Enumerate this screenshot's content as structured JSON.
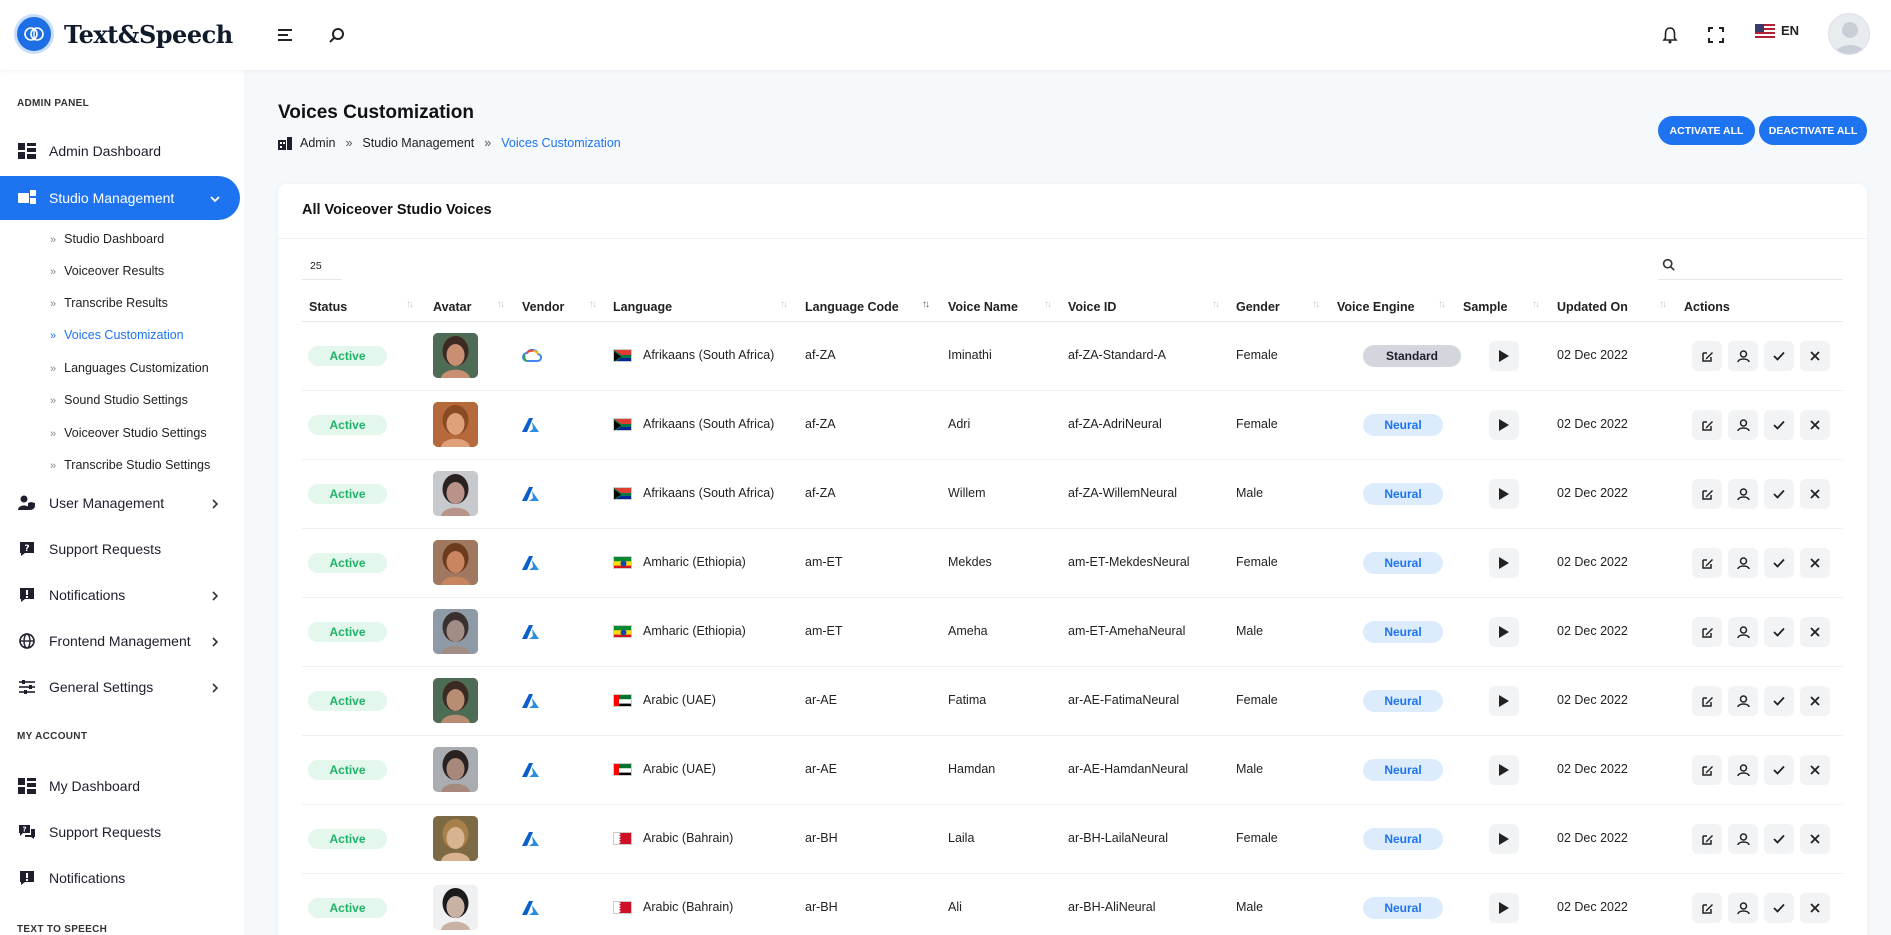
{
  "app": {
    "logo_text": "Text&Speech",
    "language": "EN"
  },
  "sidebar": {
    "section_admin": "ADMIN PANEL",
    "admin_dashboard": "Admin Dashboard",
    "studio_management": "Studio Management",
    "sub_items": [
      "Studio Dashboard",
      "Voiceover Results",
      "Transcribe Results",
      "Voices Customization",
      "Languages Customization",
      "Sound Studio Settings",
      "Voiceover Studio Settings",
      "Transcribe Studio Settings"
    ],
    "user_management": "User Management",
    "support_requests": "Support Requests",
    "notifications": "Notifications",
    "frontend_management": "Frontend Management",
    "general_settings": "General Settings",
    "section_account": "MY ACCOUNT",
    "my_dashboard": "My Dashboard",
    "my_support_requests": "Support Requests",
    "my_notifications": "Notifications",
    "section_tts": "TEXT TO SPEECH"
  },
  "header": {
    "title": "Voices Customization",
    "breadcrumb": [
      "Admin",
      "Studio Management",
      "Voices Customization"
    ],
    "breadcrumb_sep": "»",
    "activate_all": "ACTIVATE ALL",
    "deactivate_all": "DEACTIVATE ALL"
  },
  "card": {
    "title": "All Voiceover Studio Voices",
    "page_size": "25"
  },
  "table": {
    "columns": [
      "Status",
      "Avatar",
      "Vendor",
      "Language",
      "Language Code",
      "Voice Name",
      "Voice ID",
      "Gender",
      "Voice Engine",
      "Sample",
      "Updated On",
      "Actions"
    ],
    "rows": [
      {
        "status": "Active",
        "vendor": "gcp",
        "language": "Afrikaans (South Africa)",
        "flag": "za",
        "code": "af-ZA",
        "name": "Iminathi",
        "id": "af-ZA-Standard-A",
        "gender": "Female",
        "engine": "Standard",
        "updated": "02 Dec 2022"
      },
      {
        "status": "Active",
        "vendor": "azure",
        "language": "Afrikaans (South Africa)",
        "flag": "za",
        "code": "af-ZA",
        "name": "Adri",
        "id": "af-ZA-AdriNeural",
        "gender": "Female",
        "engine": "Neural",
        "updated": "02 Dec 2022"
      },
      {
        "status": "Active",
        "vendor": "azure",
        "language": "Afrikaans (South Africa)",
        "flag": "za",
        "code": "af-ZA",
        "name": "Willem",
        "id": "af-ZA-WillemNeural",
        "gender": "Male",
        "engine": "Neural",
        "updated": "02 Dec 2022"
      },
      {
        "status": "Active",
        "vendor": "azure",
        "language": "Amharic (Ethiopia)",
        "flag": "et",
        "code": "am-ET",
        "name": "Mekdes",
        "id": "am-ET-MekdesNeural",
        "gender": "Female",
        "engine": "Neural",
        "updated": "02 Dec 2022"
      },
      {
        "status": "Active",
        "vendor": "azure",
        "language": "Amharic (Ethiopia)",
        "flag": "et",
        "code": "am-ET",
        "name": "Ameha",
        "id": "am-ET-AmehaNeural",
        "gender": "Male",
        "engine": "Neural",
        "updated": "02 Dec 2022"
      },
      {
        "status": "Active",
        "vendor": "azure",
        "language": "Arabic (UAE)",
        "flag": "ae",
        "code": "ar-AE",
        "name": "Fatima",
        "id": "ar-AE-FatimaNeural",
        "gender": "Female",
        "engine": "Neural",
        "updated": "02 Dec 2022"
      },
      {
        "status": "Active",
        "vendor": "azure",
        "language": "Arabic (UAE)",
        "flag": "ae",
        "code": "ar-AE",
        "name": "Hamdan",
        "id": "ar-AE-HamdanNeural",
        "gender": "Male",
        "engine": "Neural",
        "updated": "02 Dec 2022"
      },
      {
        "status": "Active",
        "vendor": "azure",
        "language": "Arabic (Bahrain)",
        "flag": "bh",
        "code": "ar-BH",
        "name": "Laila",
        "id": "ar-BH-LailaNeural",
        "gender": "Female",
        "engine": "Neural",
        "updated": "02 Dec 2022"
      },
      {
        "status": "Active",
        "vendor": "azure",
        "language": "Arabic (Bahrain)",
        "flag": "bh",
        "code": "ar-BH",
        "name": "Ali",
        "id": "ar-BH-AliNeural",
        "gender": "Male",
        "engine": "Neural",
        "updated": "02 Dec 2022"
      }
    ]
  },
  "colors": {
    "accent": "#1e73f0",
    "active_bg": "#e3f7ec",
    "active_text": "#21b26a",
    "neural_bg": "#dcecfd",
    "standard_bg": "#d3d6dd"
  }
}
